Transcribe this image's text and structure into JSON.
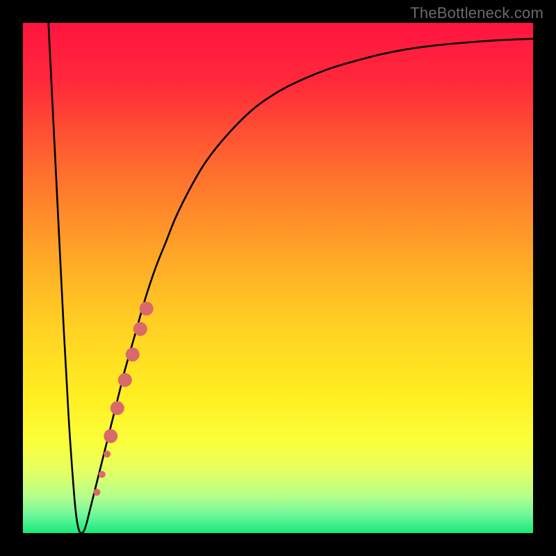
{
  "watermark": "TheBottleneck.com",
  "chart_data": {
    "type": "line",
    "title": "",
    "xlabel": "",
    "ylabel": "",
    "xlim": [
      0,
      100
    ],
    "ylim": [
      0,
      100
    ],
    "grid": false,
    "legend": false,
    "series": [
      {
        "name": "bottleneck-curve",
        "x": [
          5,
          6,
          7,
          8,
          9,
          10,
          10.5,
          11,
          11.5,
          12,
          12.5,
          13,
          13.5,
          14,
          15,
          16,
          17,
          18,
          19,
          20,
          22,
          24,
          26,
          28,
          30,
          33,
          36,
          40,
          45,
          50,
          55,
          60,
          65,
          70,
          75,
          80,
          85,
          90,
          95,
          100
        ],
        "y": [
          100,
          80,
          60,
          40,
          22,
          8,
          3,
          0.5,
          0,
          0.5,
          2,
          4,
          6,
          8,
          12,
          16,
          20,
          24,
          28,
          32,
          39,
          46,
          52,
          57,
          62,
          68,
          73,
          78,
          83,
          86.5,
          89,
          91,
          92.5,
          93.8,
          94.8,
          95.5,
          96,
          96.4,
          96.7,
          96.9
        ]
      }
    ],
    "markers": {
      "name": "scatter-points",
      "color": "#d86a6a",
      "points": [
        {
          "x": 14.5,
          "y": 8.0,
          "r": 5
        },
        {
          "x": 15.5,
          "y": 11.5,
          "r": 5
        },
        {
          "x": 16.5,
          "y": 15.5,
          "r": 5
        },
        {
          "x": 17.2,
          "y": 19.0,
          "r": 10
        },
        {
          "x": 18.5,
          "y": 24.5,
          "r": 10
        },
        {
          "x": 20.0,
          "y": 30.0,
          "r": 10
        },
        {
          "x": 21.5,
          "y": 35.0,
          "r": 10
        },
        {
          "x": 23.0,
          "y": 40.0,
          "r": 10
        },
        {
          "x": 24.2,
          "y": 44.0,
          "r": 10
        }
      ]
    },
    "background_gradient": {
      "stops": [
        {
          "offset": 0.0,
          "color": "#ff1440"
        },
        {
          "offset": 0.12,
          "color": "#ff2a3a"
        },
        {
          "offset": 0.28,
          "color": "#ff6a2f"
        },
        {
          "offset": 0.45,
          "color": "#ffa527"
        },
        {
          "offset": 0.6,
          "color": "#ffd223"
        },
        {
          "offset": 0.74,
          "color": "#fff022"
        },
        {
          "offset": 0.82,
          "color": "#fbff3a"
        },
        {
          "offset": 0.88,
          "color": "#e4ff63"
        },
        {
          "offset": 0.93,
          "color": "#b2ff8c"
        },
        {
          "offset": 0.965,
          "color": "#6cf79c"
        },
        {
          "offset": 1.0,
          "color": "#18e87a"
        }
      ]
    }
  }
}
